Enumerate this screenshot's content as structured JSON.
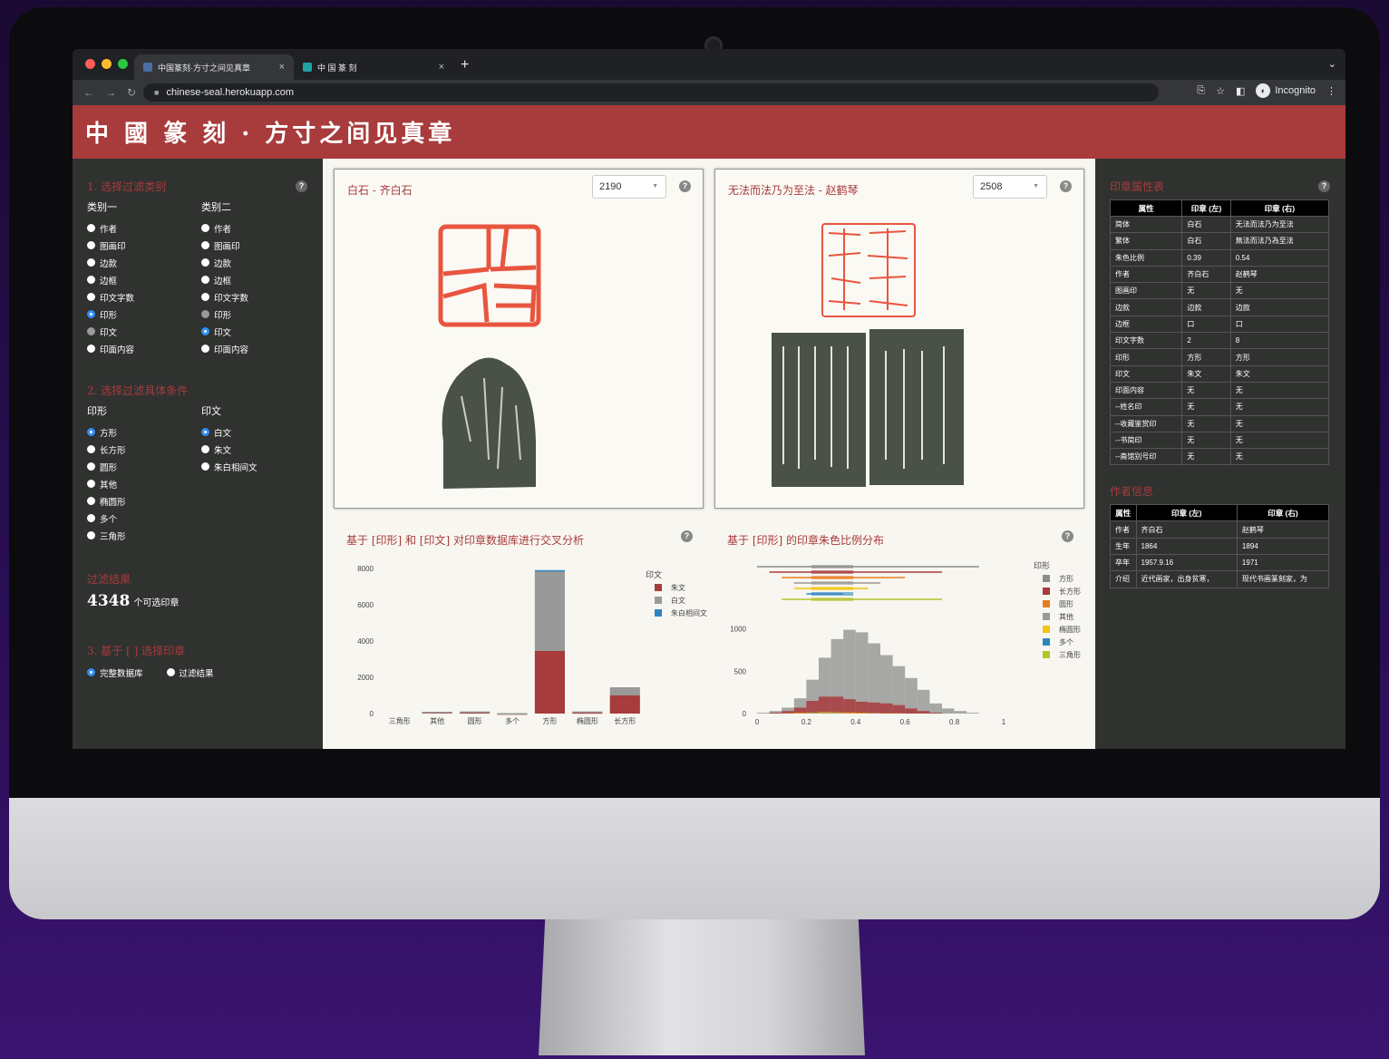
{
  "browser": {
    "tabs": [
      {
        "title": "中国篆刻·方寸之间见真章",
        "close": "×"
      },
      {
        "title": "中 国 篆 刻",
        "close": "×"
      }
    ],
    "new_tab": "+",
    "url": "chinese-seal.herokuapp.com",
    "incognito_label": "Incognito"
  },
  "header": {
    "title": "中 國 篆 刻 · 方寸之间见真章"
  },
  "left": {
    "section1_title": "1. 选择过滤类别",
    "cat1_label": "类别一",
    "cat2_label": "类别二",
    "cat1_options": [
      {
        "label": "作者",
        "state": "off"
      },
      {
        "label": "图画印",
        "state": "off"
      },
      {
        "label": "边款",
        "state": "off"
      },
      {
        "label": "边框",
        "state": "off"
      },
      {
        "label": "印文字数",
        "state": "off"
      },
      {
        "label": "印形",
        "state": "sel"
      },
      {
        "label": "印文",
        "state": "dim"
      },
      {
        "label": "印面内容",
        "state": "off"
      }
    ],
    "cat2_options": [
      {
        "label": "作者",
        "state": "off"
      },
      {
        "label": "图画印",
        "state": "off"
      },
      {
        "label": "边款",
        "state": "off"
      },
      {
        "label": "边框",
        "state": "off"
      },
      {
        "label": "印文字数",
        "state": "off"
      },
      {
        "label": "印形",
        "state": "dim"
      },
      {
        "label": "印文",
        "state": "sel"
      },
      {
        "label": "印面内容",
        "state": "off"
      }
    ],
    "section2_title": "2. 选择过滤具体条件",
    "cond1_label": "印形",
    "cond2_label": "印文",
    "cond1_options": [
      {
        "label": "方形",
        "state": "sel"
      },
      {
        "label": "长方形",
        "state": "off"
      },
      {
        "label": "圆形",
        "state": "off"
      },
      {
        "label": "其他",
        "state": "off"
      },
      {
        "label": "椭圆形",
        "state": "off"
      },
      {
        "label": "多个",
        "state": "off"
      },
      {
        "label": "三角形",
        "state": "off"
      }
    ],
    "cond2_options": [
      {
        "label": "白文",
        "state": "sel"
      },
      {
        "label": "朱文",
        "state": "off"
      },
      {
        "label": "朱白相间文",
        "state": "off"
      }
    ],
    "result_title": "过滤结果",
    "result_count": "4348",
    "result_suffix": "个可选印章",
    "section3_title": "3. 基于 [ ] 选择印章",
    "source_options": [
      {
        "label": "完整数据库",
        "state": "sel"
      },
      {
        "label": "过滤结果",
        "state": "off"
      }
    ]
  },
  "seal_left": {
    "title": "白石 - 齐白石",
    "select_value": "2190"
  },
  "seal_right": {
    "title": "无法而法乃为至法 - 赵鹤琴",
    "select_value": "2508"
  },
  "chart1_title": "基于 [印形] 和 [印文] 对印章数据库进行交叉分析",
  "chart2_title": "基于 [印形] 的印章朱色比例分布",
  "chart_data": [
    {
      "type": "bar",
      "categories": [
        "三角形",
        "其他",
        "圆形",
        "多个",
        "方形",
        "椭圆形",
        "长方形"
      ],
      "series": [
        {
          "name": "朱文",
          "color": "#a83b3c",
          "values": [
            0,
            80,
            90,
            10,
            3450,
            70,
            1000
          ]
        },
        {
          "name": "白文",
          "color": "#999999",
          "values": [
            0,
            20,
            30,
            15,
            4400,
            50,
            450
          ]
        },
        {
          "name": "朱白相间文",
          "color": "#2e86c1",
          "values": [
            0,
            0,
            0,
            0,
            60,
            0,
            0
          ]
        }
      ],
      "legend_title": "印文",
      "yticks": [
        "0",
        "2000",
        "4000",
        "6000",
        "8000"
      ],
      "ylim": [
        0,
        8000
      ],
      "legend": "right"
    },
    {
      "type": "histogram",
      "x": [
        0,
        0.05,
        0.1,
        0.15,
        0.2,
        0.25,
        0.3,
        0.35,
        0.4,
        0.45,
        0.5,
        0.55,
        0.6,
        0.65,
        0.7,
        0.75,
        0.8,
        0.85
      ],
      "series": [
        {
          "name": "方形",
          "color": "#8c8c8c",
          "values": [
            10,
            30,
            70,
            180,
            400,
            660,
            880,
            990,
            960,
            830,
            690,
            560,
            420,
            280,
            120,
            60,
            30,
            10
          ]
        },
        {
          "name": "长方形",
          "color": "#a83b3c",
          "values": [
            0,
            10,
            30,
            70,
            150,
            200,
            200,
            170,
            140,
            130,
            120,
            100,
            60,
            30,
            10,
            0,
            0,
            0
          ]
        },
        {
          "name": "圆形",
          "color": "#e67e22",
          "values": [
            0,
            0,
            5,
            10,
            15,
            20,
            20,
            15,
            10,
            10,
            5,
            5,
            0,
            0,
            0,
            0,
            0,
            0
          ]
        },
        {
          "name": "其他",
          "color": "#999999",
          "values": [
            0,
            0,
            0,
            5,
            5,
            10,
            10,
            5,
            5,
            5,
            0,
            0,
            0,
            0,
            0,
            0,
            0,
            0
          ]
        },
        {
          "name": "椭圆形",
          "color": "#f1c40f",
          "values": [
            0,
            0,
            0,
            5,
            10,
            15,
            10,
            5,
            5,
            0,
            0,
            0,
            0,
            0,
            0,
            0,
            0,
            0
          ]
        },
        {
          "name": "多个",
          "color": "#2e86c1",
          "values": [
            0,
            0,
            0,
            0,
            5,
            5,
            5,
            0,
            0,
            0,
            0,
            0,
            0,
            0,
            0,
            0,
            0,
            0
          ]
        },
        {
          "name": "三角形",
          "color": "#b5c42d",
          "values": [
            0,
            0,
            0,
            0,
            0,
            0,
            0,
            0,
            0,
            0,
            0,
            0,
            0,
            0,
            0,
            0,
            0,
            0
          ]
        }
      ],
      "legend_title": "印形",
      "xticks": [
        "0",
        "0.2",
        "0.4",
        "0.6",
        "0.8",
        "1"
      ],
      "yticks": [
        "0",
        "500",
        "1000"
      ],
      "xlim": [
        0,
        1
      ],
      "ylim": [
        0,
        1200
      ],
      "legend": "right"
    }
  ],
  "props": {
    "title": "印章属性表",
    "headers": [
      "属性",
      "印章 (左)",
      "印章 (右)"
    ],
    "rows": [
      [
        "简体",
        "白石",
        "无法而法乃为至法"
      ],
      [
        "繁体",
        "白石",
        "無法而法乃為至法"
      ],
      [
        "朱色比例",
        "0.39",
        "0.54"
      ],
      [
        "作者",
        "齐白石",
        "赵鹤琴"
      ],
      [
        "图画印",
        "无",
        "无"
      ],
      [
        "边款",
        "边款",
        "边款"
      ],
      [
        "边框",
        "口",
        "口"
      ],
      [
        "印文字数",
        "2",
        "8"
      ],
      [
        "印形",
        "方形",
        "方形"
      ],
      [
        "印文",
        "朱文",
        "朱文"
      ],
      [
        "印面内容",
        "无",
        "无"
      ],
      [
        "--姓名印",
        "无",
        "无"
      ],
      [
        "--收藏鉴赏印",
        "无",
        "无"
      ],
      [
        "--书简印",
        "无",
        "无"
      ],
      [
        "--斋馆别号印",
        "无",
        "无"
      ]
    ]
  },
  "author": {
    "title": "作者信息",
    "headers": [
      "属性",
      "印章 (左)",
      "印章 (右)"
    ],
    "rows": [
      [
        "作者",
        "齐白石",
        "赵鹤琴"
      ],
      [
        "生年",
        "1864",
        "1894"
      ],
      [
        "卒年",
        "1957.9.16",
        "1971"
      ],
      [
        "介绍",
        "近代画家，出身贫寒，",
        "现代书画篆刻家，为"
      ]
    ]
  }
}
